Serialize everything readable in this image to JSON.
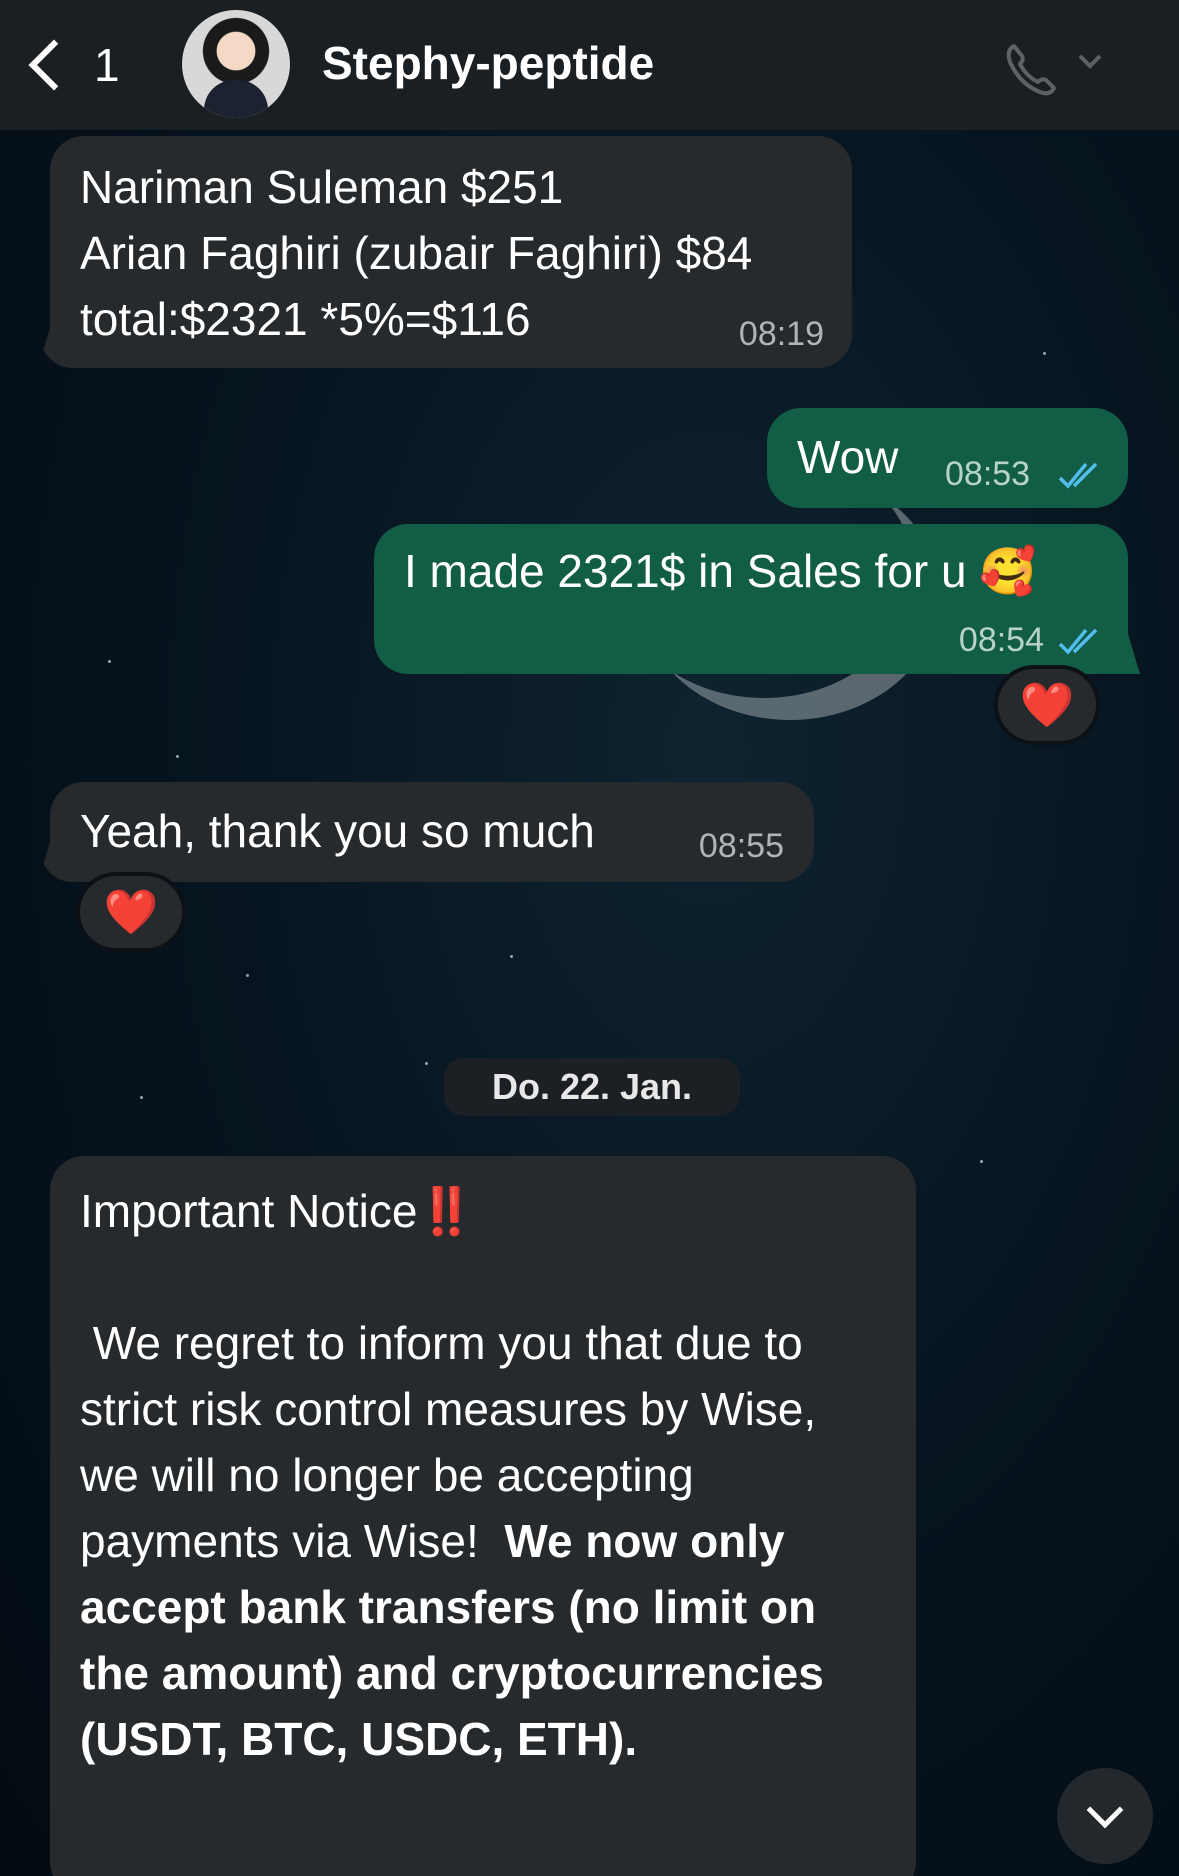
{
  "header": {
    "unread_count": "1",
    "contact_name": "Stephy-peptide"
  },
  "messages": [
    {
      "direction": "in",
      "lines": [
        "Nariman Suleman  $251",
        "Arian Faghiri (zubair Faghiri) $84",
        "total:$2321 *5%=$116"
      ],
      "time": "08:19"
    },
    {
      "direction": "out",
      "text": "Wow",
      "time": "08:53",
      "status": "read"
    },
    {
      "direction": "out",
      "text": "I made 2321$ in Sales for u 🥰",
      "time": "08:54",
      "status": "read",
      "reaction": "❤️"
    },
    {
      "direction": "in",
      "text": "Yeah, thank you so much",
      "time": "08:55",
      "reaction": "❤️"
    }
  ],
  "date_separator": "Do. 22. Jan.",
  "notice": {
    "title": "Important Notice",
    "title_emoji": "‼️",
    "body_regular": " We regret to inform you that due to strict risk control measures by Wise, we will no longer be accepting payments via Wise!  ",
    "body_bold": "We now only accept bank transfers (no limit on the amount) and cryptocurrencies (USDT, BTC, USDC, ETH)."
  },
  "colors": {
    "incoming_bubble": "#262a2d",
    "outgoing_bubble": "#125d46",
    "read_ticks": "#53bdeb",
    "header_bg": "#1a1f23"
  },
  "icons": [
    "back-chevron-icon",
    "phone-icon",
    "chevron-down-icon",
    "double-check-icon",
    "scroll-down-icon"
  ]
}
